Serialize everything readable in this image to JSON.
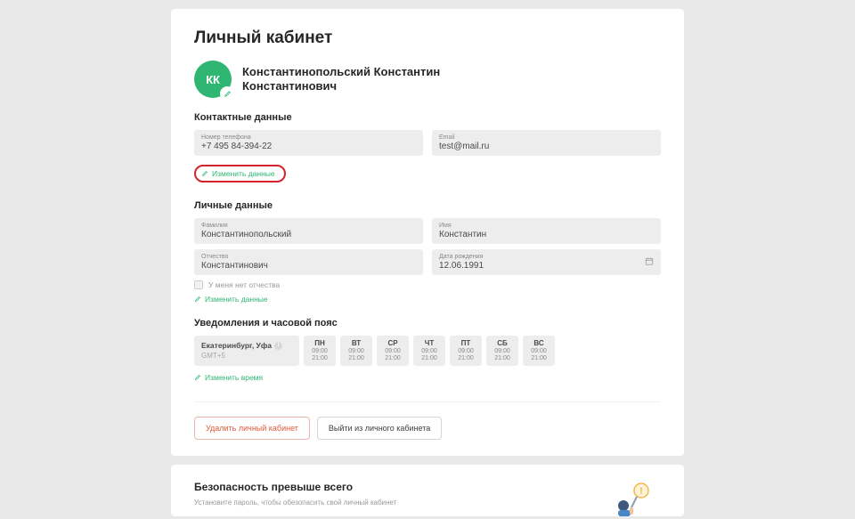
{
  "page_title": "Личный кабинет",
  "avatar_initials": "КК",
  "full_name_line1": "Константинопольский Константин",
  "full_name_line2": "Константинович",
  "contact": {
    "title": "Контактные данные",
    "phone_label": "Номер телефона",
    "phone_value": "+7 495 84-394-22",
    "email_label": "Email",
    "email_value": "test@mail.ru",
    "edit": "Изменить данные"
  },
  "personal": {
    "title": "Личные данные",
    "surname_label": "Фамилия",
    "surname_value": "Константинопольский",
    "name_label": "Имя",
    "name_value": "Константин",
    "patronymic_label": "Отчество",
    "patronymic_value": "Константинович",
    "dob_label": "Дата рождения",
    "dob_value": "12.06.1991",
    "no_patronymic": "У меня нет отчества",
    "edit": "Изменить данные"
  },
  "notifications": {
    "title": "Уведомления и часовой пояс",
    "city": "Екатеринбург, Уфа",
    "offset": "GMT+5",
    "days": [
      {
        "name": "ПН",
        "from": "09:00",
        "to": "21:00"
      },
      {
        "name": "ВТ",
        "from": "09:00",
        "to": "21:00"
      },
      {
        "name": "СР",
        "from": "09:00",
        "to": "21:00"
      },
      {
        "name": "ЧТ",
        "from": "09:00",
        "to": "21:00"
      },
      {
        "name": "ПТ",
        "from": "09:00",
        "to": "21:00"
      },
      {
        "name": "СБ",
        "from": "09:00",
        "to": "21:00"
      },
      {
        "name": "ВС",
        "from": "09:00",
        "to": "21:00"
      }
    ],
    "edit": "Изменить время"
  },
  "actions": {
    "delete": "Удалить личный кабинет",
    "logout": "Выйти из личного кабинета"
  },
  "security": {
    "title": "Безопасность превыше всего",
    "subtitle": "Установите пароль, чтобы обезопасить свой личный кабинет"
  }
}
